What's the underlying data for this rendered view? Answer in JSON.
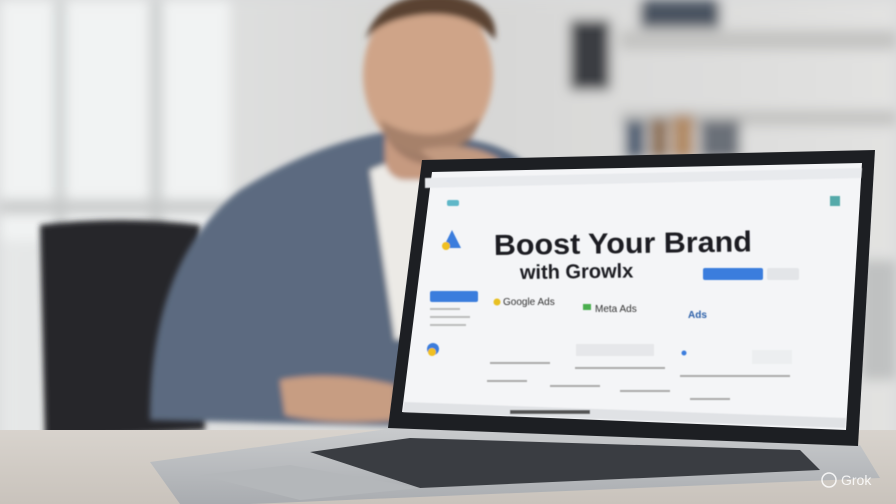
{
  "screen": {
    "headline": "Boost Your Brand",
    "subheadline": "with Growlx",
    "brand_cards": [
      "Google Ads",
      "Meta Ads",
      "Ads"
    ],
    "sidebar_button": "",
    "cta_button": ""
  },
  "watermark": "Grok",
  "colors": {
    "accent": "#3b7ddd",
    "blazer": "#5b6a80",
    "wall": "#dcdcdc"
  }
}
